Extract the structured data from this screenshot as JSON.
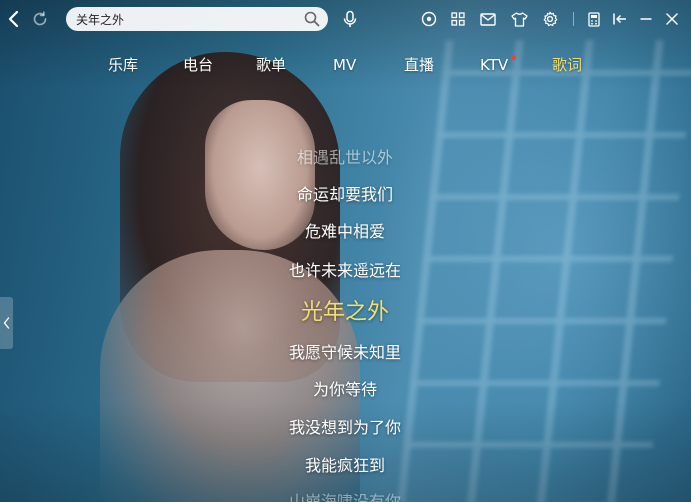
{
  "search": {
    "value": "关年之外",
    "placeholder": ""
  },
  "tabs": [
    {
      "label": "乐库",
      "active": false,
      "badge": false
    },
    {
      "label": "电台",
      "active": false,
      "badge": false
    },
    {
      "label": "歌单",
      "active": false,
      "badge": false
    },
    {
      "label": "MV",
      "active": false,
      "badge": false
    },
    {
      "label": "直播",
      "active": false,
      "badge": false
    },
    {
      "label": "KTV",
      "active": false,
      "badge": true
    },
    {
      "label": "歌词",
      "active": true,
      "badge": false
    }
  ],
  "lyrics": {
    "lines": [
      "相遇乱世以外",
      "命运却要我们",
      "危难中相爱",
      "也许未来遥远在",
      "光年之外",
      "我愿守候未知里",
      "为你等待",
      "我没想到为了你",
      "我能疯狂到",
      "山崩海啸没有你"
    ],
    "current_index": 4
  },
  "icons": {
    "back": "back-arrow-icon",
    "refresh": "refresh-icon",
    "search": "search-icon",
    "voice": "microphone-icon",
    "toolbar": [
      "record-icon",
      "grid-apps-icon",
      "mail-icon",
      "skin-tshirt-icon",
      "settings-gear-icon",
      "calculator-icon",
      "mini-mode-icon",
      "minimize-icon",
      "close-icon"
    ]
  },
  "colors": {
    "accent": "#f1df74",
    "badge": "#ff3b30",
    "text": "#ffffff"
  }
}
